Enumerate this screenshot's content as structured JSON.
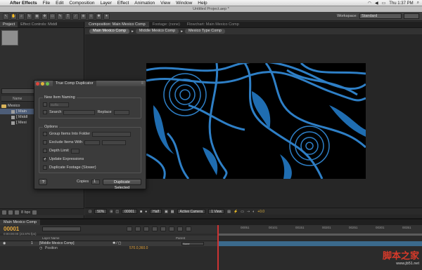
{
  "menubar": {
    "app": "After Effects",
    "items": [
      "File",
      "Edit",
      "Composition",
      "Layer",
      "Effect",
      "Animation",
      "View",
      "Window",
      "Help"
    ],
    "clock": "Thu 1:37 PM"
  },
  "window_title": "Untitled Project.aep *",
  "workspace": {
    "label": "Workspace:",
    "value": "Standard"
  },
  "project_panel": {
    "tabs": [
      "Project",
      "Effect Controls: Middl"
    ],
    "name_header": "Name",
    "items": [
      {
        "label": "Mexico",
        "type": "folder"
      },
      {
        "label": "[ Main",
        "type": "comp"
      },
      {
        "label": "[ Middl",
        "type": "comp"
      },
      {
        "label": "[ Mexi",
        "type": "comp"
      }
    ],
    "bpc": "8 bpc"
  },
  "viewer": {
    "tabs": [
      "Composition: Main Mexico Comp",
      "Footage: (none)",
      "Flowchart: Main Mexico Comp"
    ],
    "breadcrumbs": [
      "Main Mexico Comp",
      "Middle Mexico Comp",
      "Mexico Type Comp"
    ],
    "footer": {
      "zoom": "50%",
      "timecode": "00001",
      "resolution": "Half",
      "camera": "Active Camera",
      "view": "1 View",
      "exposure": "+0.0"
    },
    "colors": {
      "accent_blue": "#2e7fc6",
      "background": "#000000"
    }
  },
  "script_panel": {
    "title": "True Comp Duplicator",
    "new_item_naming": {
      "label": "New Item Naming",
      "suffix_placeholder": "Suffix",
      "search_label": "Search",
      "replace_label": "Replace"
    },
    "options": {
      "label": "Options",
      "group_into_folder": "Group Items Into Folder",
      "exclude_items_with": "Exclude Items With",
      "depth_limit": "Depth Limit",
      "update_expressions": "Update Expressions",
      "duplicate_footage": "Duplicate Footage (Slower)"
    },
    "help_button": "?",
    "copies_label": "Copies",
    "copies_value": "1",
    "duplicate_button": "Duplicate Selected"
  },
  "timeline": {
    "tab": "Main Mexico Comp",
    "timecode": "00001",
    "fps": "0:00:00:00 (23.976 fps)",
    "ruler": [
      "00051",
      "00101",
      "00151",
      "00201",
      "00251",
      "00301",
      "00351"
    ],
    "columns": {
      "layer_name": "Layer Name",
      "parent": "Parent"
    },
    "layer": {
      "number": "1",
      "name": "[Middle Mexico Comp]",
      "parent": "None"
    },
    "property": {
      "name": "Position",
      "value": "570.0,360.0"
    }
  },
  "watermark": {
    "line1": "脚本之家",
    "line2": "www.jb51.net"
  }
}
